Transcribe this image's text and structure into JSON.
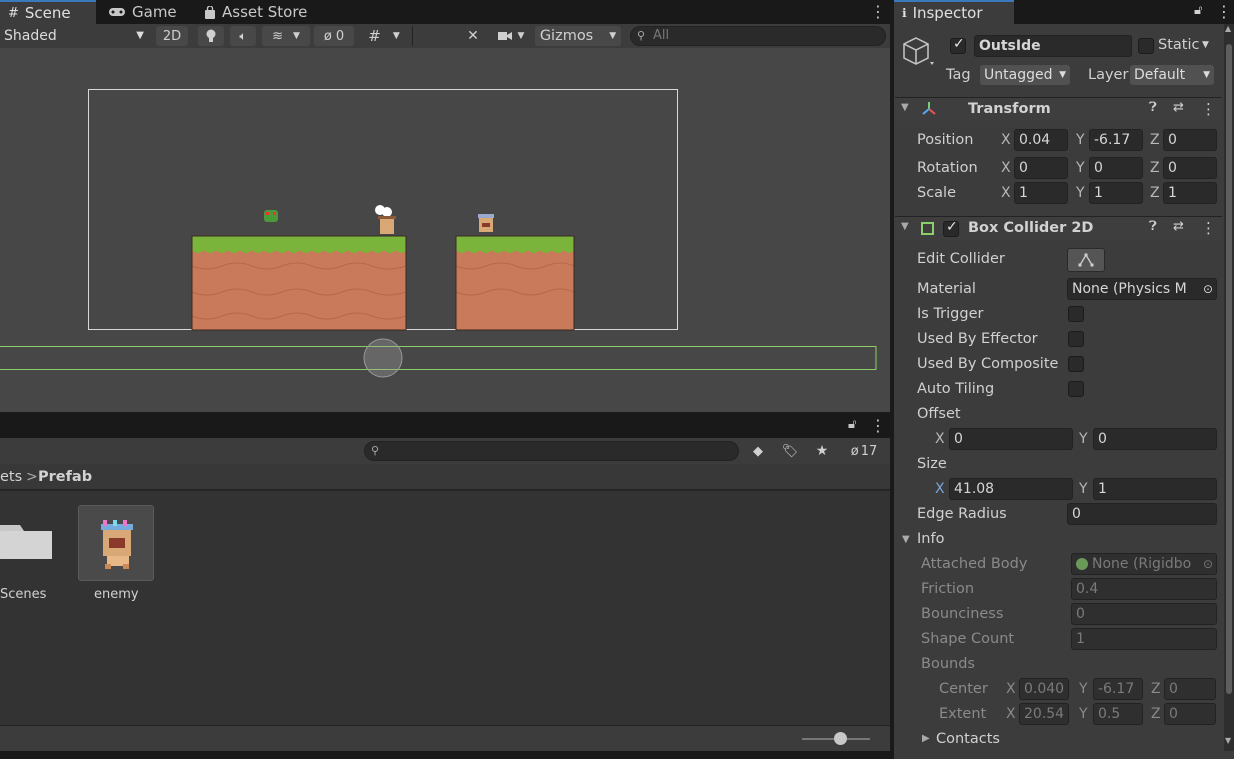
{
  "scene_tabs": [
    {
      "label": "Scene",
      "icon": "grid-icon",
      "active": true
    },
    {
      "label": "Game",
      "icon": "gamepad-icon",
      "active": false
    },
    {
      "label": "Asset Store",
      "icon": "bag-icon",
      "active": false
    }
  ],
  "scene_toolbar": {
    "shading_mode": "Shaded",
    "mode_2d": "2D",
    "hidden_count": "0",
    "gizmos": "Gizmos",
    "search_placeholder": "All"
  },
  "project": {
    "breadcrumb_parent": "ets",
    "breadcrumb_sep": ">",
    "breadcrumb_current": "Prefab",
    "hidden_count": "17",
    "items": [
      {
        "label": "Scenes",
        "icon": "folder-icon"
      },
      {
        "label": "enemy",
        "icon": "enemy-sprite-icon"
      }
    ]
  },
  "inspector": {
    "tab_label": "Inspector",
    "object": {
      "name": "OutsIde",
      "active": true,
      "static_label": "Static",
      "tag_label": "Tag",
      "tag_value": "Untagged",
      "layer_label": "Layer",
      "layer_value": "Default"
    },
    "transform": {
      "title": "Transform",
      "rows": [
        {
          "label": "Position",
          "x": "0.04",
          "y": "-6.17",
          "z": "0"
        },
        {
          "label": "Rotation",
          "x": "0",
          "y": "0",
          "z": "0"
        },
        {
          "label": "Scale",
          "x": "1",
          "y": "1",
          "z": "1"
        }
      ]
    },
    "box_collider": {
      "title": "Box Collider 2D",
      "enabled": true,
      "edit_collider_label": "Edit Collider",
      "material_label": "Material",
      "material_value": "None (Physics M",
      "is_trigger_label": "Is Trigger",
      "used_by_effector_label": "Used By Effector",
      "used_by_composite_label": "Used By Composite",
      "auto_tiling_label": "Auto Tiling",
      "offset_label": "Offset",
      "offset_x": "0",
      "offset_y": "0",
      "size_label": "Size",
      "size_x": "41.08",
      "size_y": "1",
      "edge_radius_label": "Edge Radius",
      "edge_radius_value": "0"
    },
    "info": {
      "title": "Info",
      "attached_body_label": "Attached Body",
      "attached_body_value": "None (Rigidbo",
      "friction_label": "Friction",
      "friction_value": "0.4",
      "bounciness_label": "Bounciness",
      "bounciness_value": "0",
      "shape_count_label": "Shape Count",
      "shape_count_value": "1",
      "bounds_label": "Bounds",
      "center_label": "Center",
      "center_x": "0.040",
      "center_y": "-6.17",
      "center_z": "0",
      "extent_label": "Extent",
      "extent_x": "20.54",
      "extent_y": "0.5",
      "extent_z": "0",
      "contacts_label": "Contacts"
    },
    "axis_labels": {
      "x": "X",
      "y": "Y",
      "z": "Z"
    }
  },
  "colors": {
    "accent": "#3a79bb",
    "collider_green": "#8ccf6a",
    "grass": "#7ab43a",
    "dirt": "#c97a5a"
  }
}
